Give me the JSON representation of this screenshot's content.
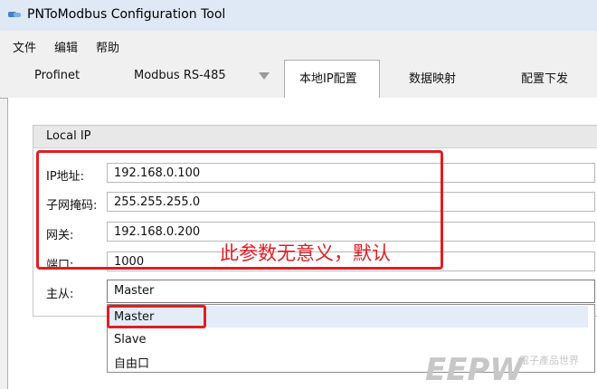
{
  "window": {
    "title": "PNToModbus Configuration Tool"
  },
  "menu": [
    "文件",
    "编辑",
    "帮助"
  ],
  "tabs": [
    "Profinet",
    "Modbus RS-485",
    "本地IP配置",
    "数据映射",
    "配置下发"
  ],
  "active_tab": "本地IP配置",
  "local_ip": {
    "group_title": "Local IP",
    "fields": [
      {
        "label": "IP地址:",
        "value": "192.168.0.100"
      },
      {
        "label": "子网掩码:",
        "value": "255.255.255.0"
      },
      {
        "label": "网关:",
        "value": "192.168.0.200"
      },
      {
        "label": "端口:",
        "value": "1000"
      }
    ],
    "role_label": "主从:",
    "role_selected": "Master",
    "role_options": [
      "Master",
      "Slave",
      "自由口"
    ]
  },
  "annotation": "此参数无意义，默认",
  "watermark": {
    "logo": "EEPW",
    "tagline": "電子產品世界"
  },
  "colors": {
    "annotation_red": "#e21d23",
    "titlebar": "#dfe9f5",
    "highlight": "#e3ecf7"
  }
}
